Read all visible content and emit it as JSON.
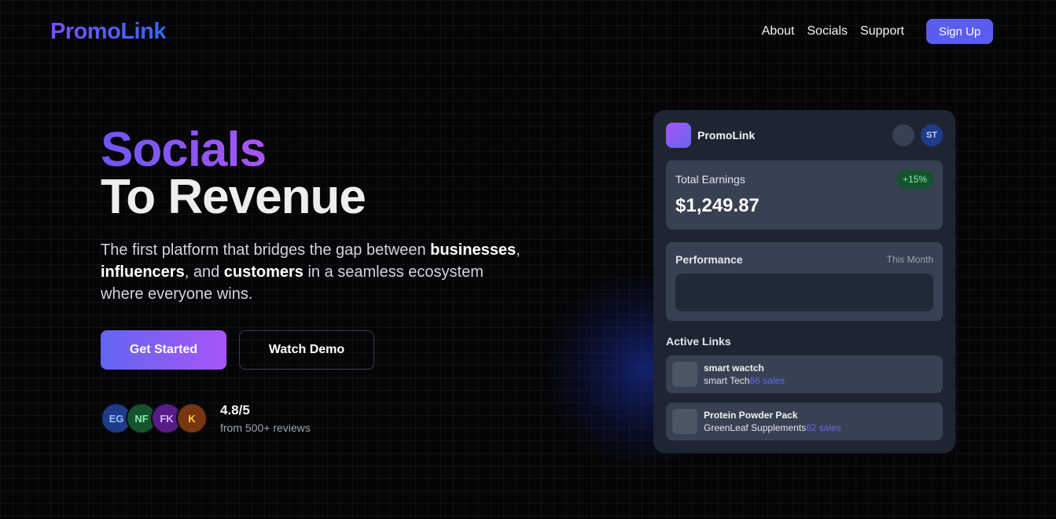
{
  "nav": {
    "logo": "PromoLink",
    "links": [
      "About",
      "Socials",
      "Support"
    ],
    "signup_label": "Sign Up"
  },
  "hero": {
    "headline_1": "Socials",
    "headline_2": "To Revenue",
    "desc_1": "The first platform that bridges the gap between ",
    "desc_b1": "businesses",
    "desc_2": ", ",
    "desc_b2": "influencers",
    "desc_3": ", and ",
    "desc_b3": "customers",
    "desc_4": " in a seamless ecosystem where everyone wins.",
    "cta_primary": "Get Started",
    "cta_secondary": "Watch Demo"
  },
  "reviews": {
    "avatars": [
      {
        "initials": "EG",
        "bg": "#1e3a8a",
        "fg": "#93c5fd"
      },
      {
        "initials": "NF",
        "bg": "#14532d",
        "fg": "#86efac"
      },
      {
        "initials": "FK",
        "bg": "#581c87",
        "fg": "#d8b4fe"
      },
      {
        "initials": "K",
        "bg": "#78350f",
        "fg": "#fcd34d"
      }
    ],
    "rating": "4.8/5",
    "subtext": "from 500+ reviews"
  },
  "dashboard": {
    "brand": "PromoLink",
    "user_initials": "ST",
    "earnings_label": "Total Earnings",
    "earnings_change": "+15%",
    "earnings_value": "$1,249.87",
    "performance_label": "Performance",
    "performance_period": "This Month",
    "active_links_label": "Active Links",
    "links": [
      {
        "name": "smart wactch",
        "vendor": "smart Tech",
        "sales": "86 sales"
      },
      {
        "name": "Protein Powder Pack",
        "vendor": "GreenLeaf Supplements",
        "sales": "62 sales"
      }
    ]
  },
  "colors": {
    "accent": "#5b5cf0",
    "gradient_start": "#6366f1",
    "gradient_end": "#a855f7",
    "badge_green": "#14532d"
  }
}
